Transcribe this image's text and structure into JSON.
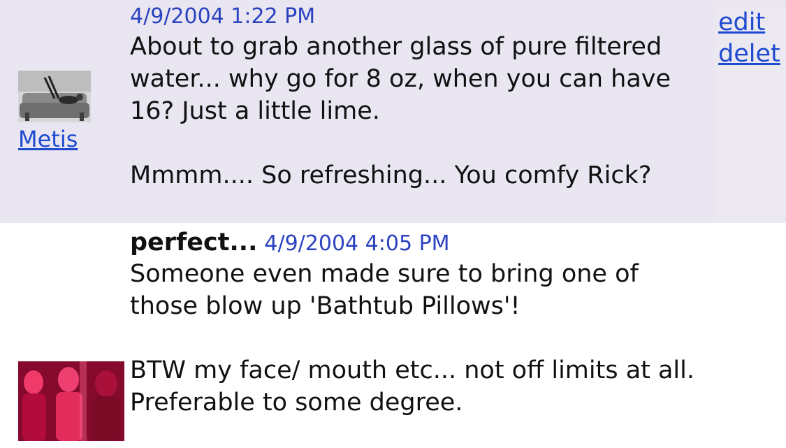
{
  "posts": [
    {
      "author": "Metis",
      "timestamp": "4/9/2004 1:22 PM",
      "body": "About to grab another glass of pure filtered water... why go for 8 oz, when you can have 16? Just a little lime.\n\nMmmm.... So refreshing... You comfy Rick?",
      "actions": {
        "edit": "edit",
        "delete": "delet"
      }
    },
    {
      "subject": "perfect...",
      "timestamp": "4/9/2004 4:05 PM",
      "body": "Someone even made sure to bring one of those blow up 'Bathtub Pillows'!\n\nBTW my face/ mouth etc... not off limits at all. Preferable to some degree."
    }
  ]
}
